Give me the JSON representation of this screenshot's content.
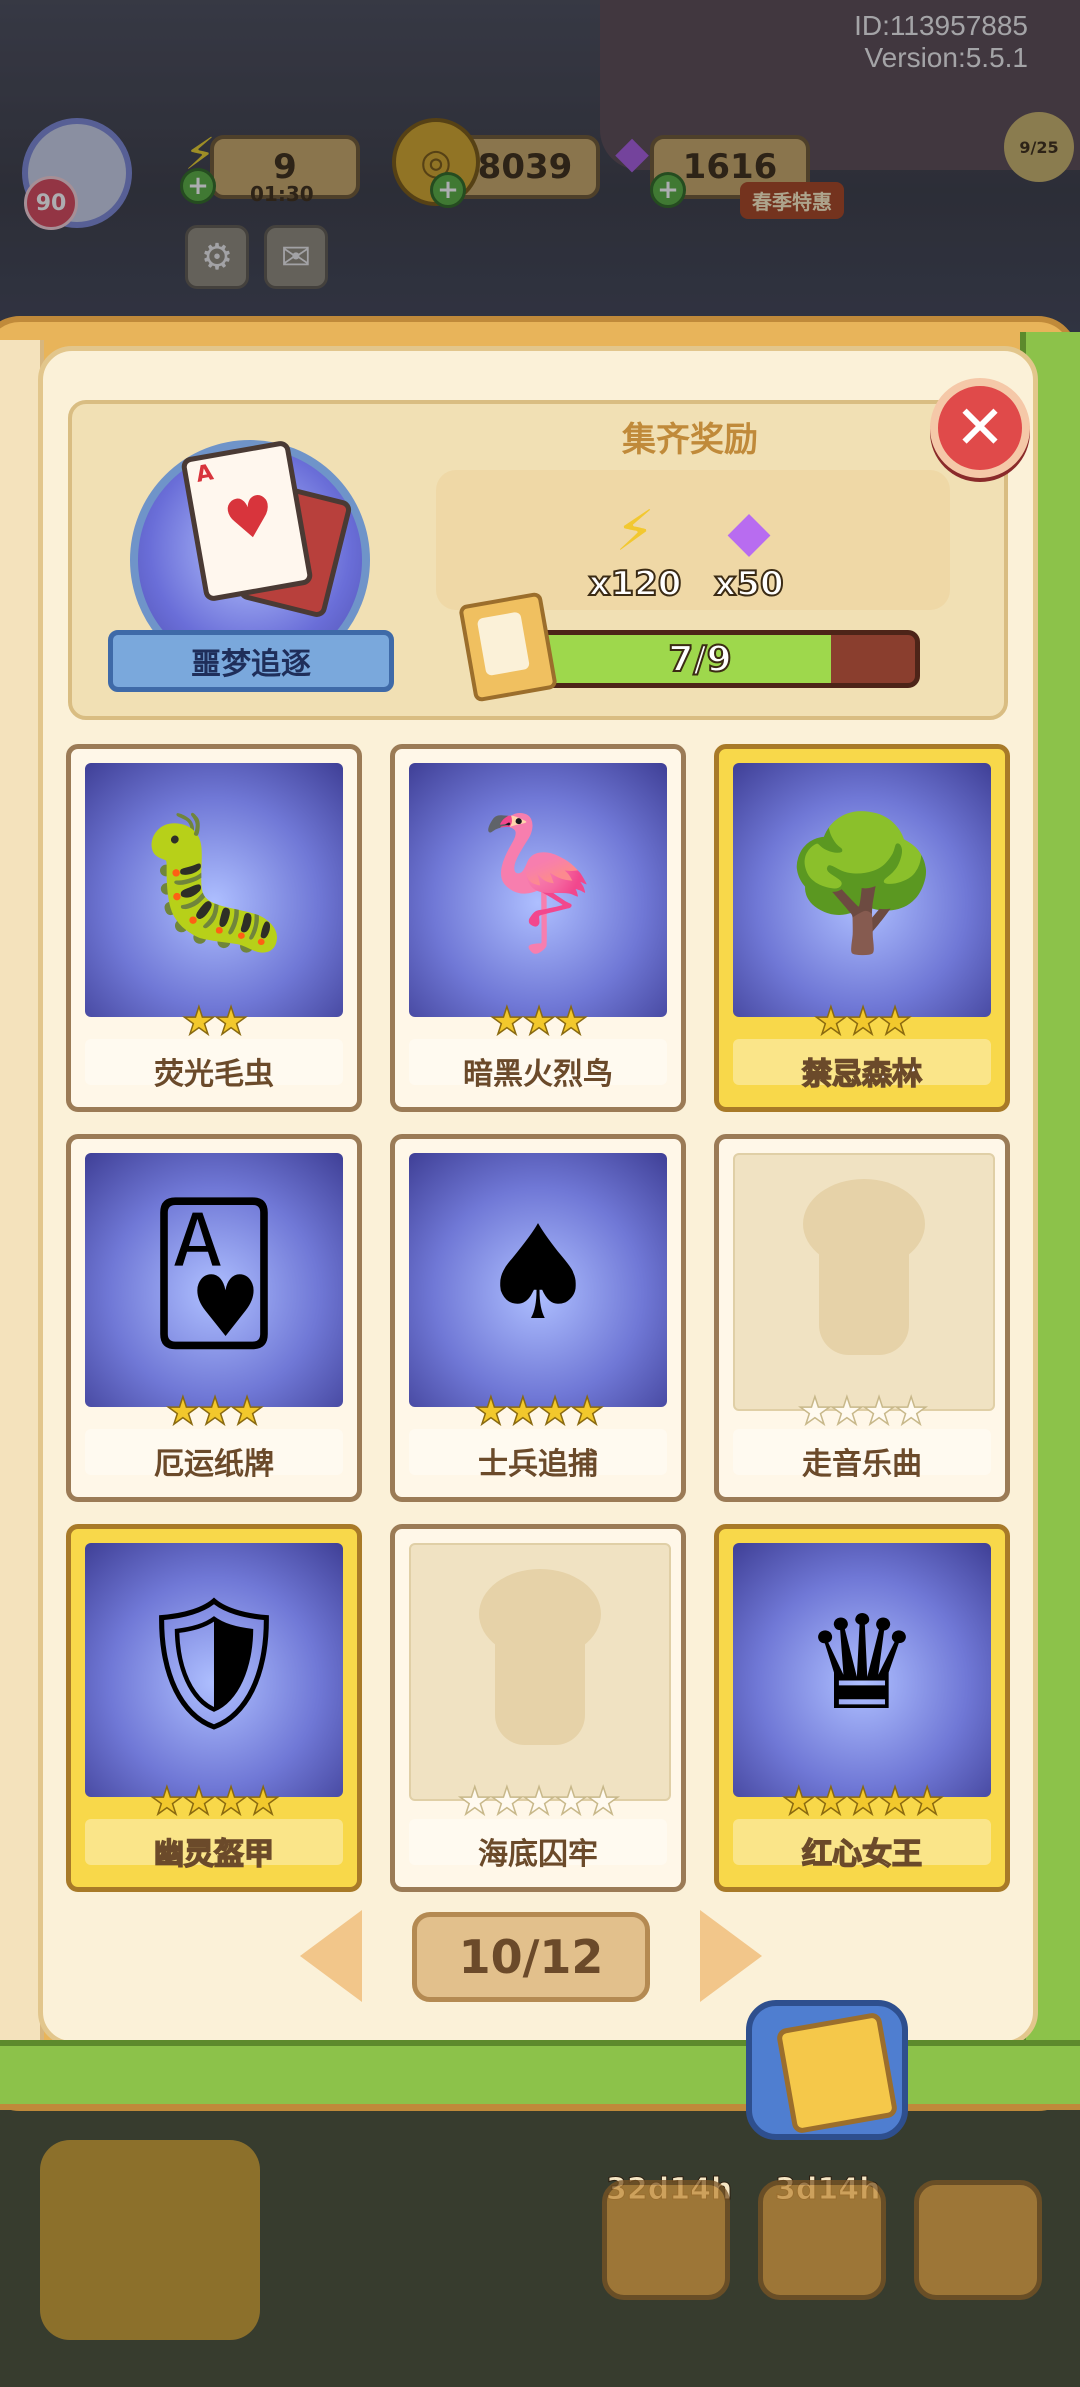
{
  "hud": {
    "player_id": "ID:113957885",
    "version": "Version:5.5.1",
    "level": "90",
    "energy": "9",
    "energy_timer": "01:30",
    "coins": "8039",
    "gems": "1616",
    "sale_label": "春季特惠",
    "side_progress": "9/25",
    "icons": {
      "energy": "lightning-icon",
      "coins": "coin-icon",
      "gems": "gem-icon",
      "settings": "gear-icon",
      "mail": "mail-icon"
    }
  },
  "album": {
    "name": "噩梦追逐",
    "reward_title": "集齐奖励",
    "rewards": [
      {
        "icon": "lightning-icon",
        "quantity": "x120"
      },
      {
        "icon": "gem-icon",
        "quantity": "x50"
      }
    ],
    "progress_text": "7/9",
    "progress_fraction": 0.7778
  },
  "cards": [
    {
      "name": "荧光毛虫",
      "stars": 2,
      "max_stars": 2,
      "gold": false,
      "collected": true,
      "art_icon": "caterpillar-on-mushroom-icon"
    },
    {
      "name": "暗黑火烈鸟",
      "stars": 3,
      "max_stars": 3,
      "gold": false,
      "collected": true,
      "art_icon": "flamingo-icon"
    },
    {
      "name": "禁忌森林",
      "stars": 3,
      "max_stars": 3,
      "gold": true,
      "collected": true,
      "art_icon": "dark-forest-icon"
    },
    {
      "name": "厄运纸牌",
      "stars": 3,
      "max_stars": 3,
      "gold": false,
      "collected": true,
      "art_icon": "heart-card-icon"
    },
    {
      "name": "士兵追捕",
      "stars": 4,
      "max_stars": 4,
      "gold": false,
      "collected": true,
      "art_icon": "card-soldiers-icon"
    },
    {
      "name": "走音乐曲",
      "stars": 0,
      "max_stars": 4,
      "gold": false,
      "collected": false,
      "art_icon": "silhouette-icon"
    },
    {
      "name": "幽灵盔甲",
      "stars": 4,
      "max_stars": 4,
      "gold": true,
      "collected": true,
      "art_icon": "knight-armor-icon"
    },
    {
      "name": "海底囚牢",
      "stars": 0,
      "max_stars": 5,
      "gold": false,
      "collected": false,
      "art_icon": "silhouette-icon"
    },
    {
      "name": "红心女王",
      "stars": 5,
      "max_stars": 5,
      "gold": true,
      "collected": true,
      "art_icon": "queen-of-hearts-icon"
    }
  ],
  "pager": {
    "label": "10/12"
  },
  "bottom": {
    "timer_1": "32d14h",
    "timer_2": "3d14h"
  },
  "colors": {
    "accent_gold": "#f8d84a",
    "progress_fill": "#9ed84c",
    "close_red": "#e04a4a"
  }
}
